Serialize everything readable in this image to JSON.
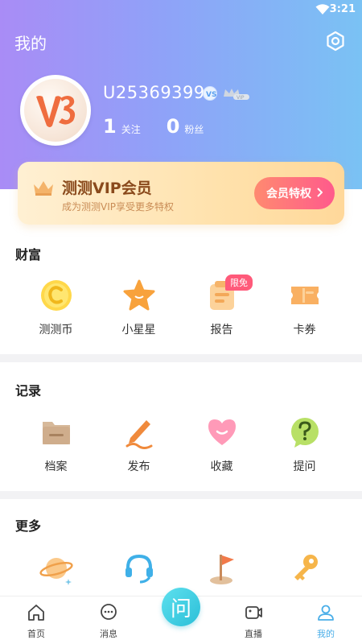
{
  "status": {
    "time": "3:21"
  },
  "header": {
    "title": "我的"
  },
  "profile": {
    "username": "U25369399",
    "following_count": "1",
    "following_label": "关注",
    "fans_count": "0",
    "fans_label": "粉丝"
  },
  "vip": {
    "title": "测测VIP会员",
    "subtitle": "成为测测VIP享受更多特权",
    "button_label": "会员特权"
  },
  "sections": {
    "wealth": {
      "title": "财富",
      "items": [
        {
          "label": "测测币",
          "icon": "coin-icon"
        },
        {
          "label": "小星星",
          "icon": "star-icon"
        },
        {
          "label": "报告",
          "icon": "report-icon",
          "tag": "限免"
        },
        {
          "label": "卡券",
          "icon": "coupon-icon"
        }
      ]
    },
    "records": {
      "title": "记录",
      "items": [
        {
          "label": "档案",
          "icon": "folder-icon"
        },
        {
          "label": "发布",
          "icon": "pen-icon"
        },
        {
          "label": "收藏",
          "icon": "heart-icon"
        },
        {
          "label": "提问",
          "icon": "question-icon"
        }
      ]
    },
    "more": {
      "title": "更多",
      "items": [
        {
          "icon": "planet-icon"
        },
        {
          "icon": "headset-icon"
        },
        {
          "icon": "flag-icon"
        },
        {
          "icon": "key-icon"
        }
      ]
    }
  },
  "nav": {
    "items": [
      {
        "label": "首页",
        "icon": "home-icon"
      },
      {
        "label": "消息",
        "icon": "message-icon"
      },
      {
        "label": "",
        "icon": "ask-icon",
        "center_char": "问"
      },
      {
        "label": "直播",
        "icon": "live-icon"
      },
      {
        "label": "我的",
        "icon": "profile-icon",
        "active": true
      }
    ]
  },
  "colors": {
    "accent": "#4aaee8",
    "vip_text": "#8a4a1c",
    "vip_button": "#ff5a8c",
    "tag": "#ff5a7a"
  }
}
